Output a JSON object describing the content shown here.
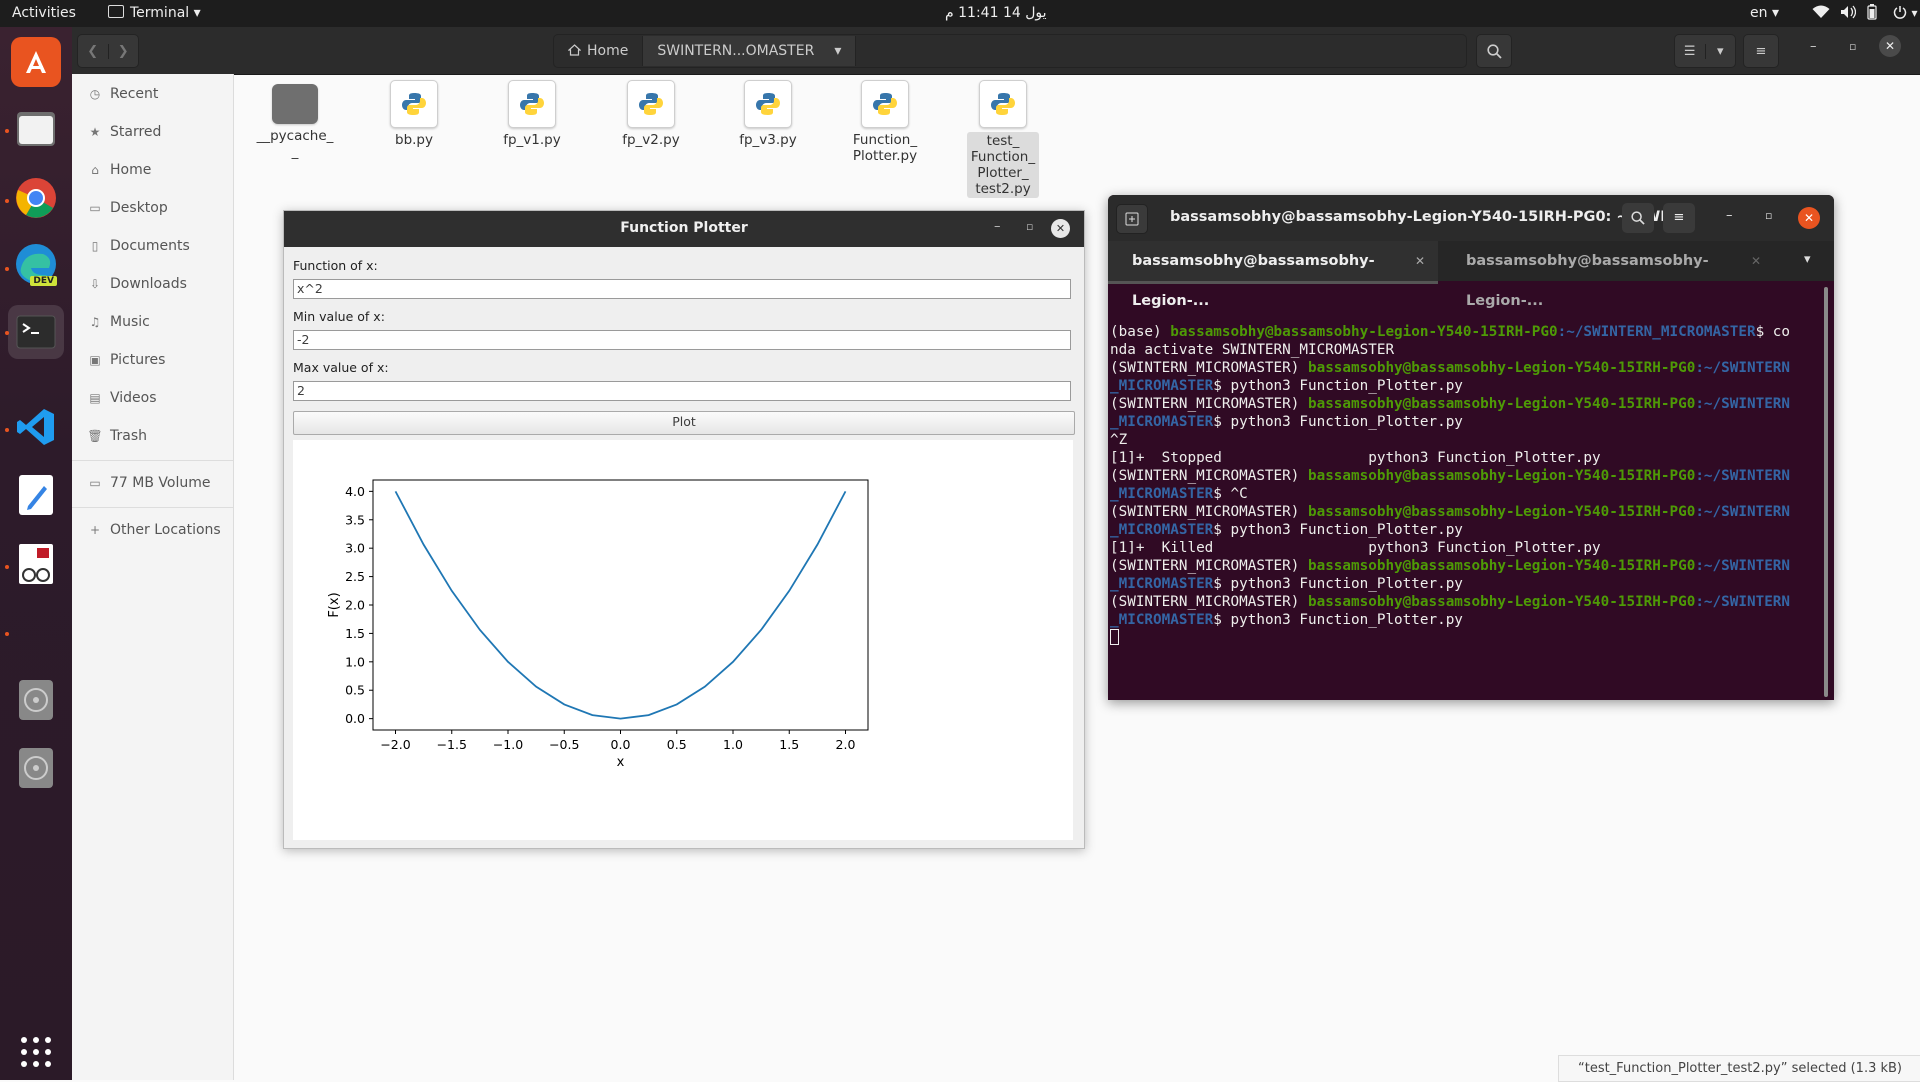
{
  "topbar": {
    "activities": "Activities",
    "app_menu": "Terminal",
    "clock": "يول 14  11:41 م",
    "lang": "en"
  },
  "files": {
    "path_home": "Home",
    "path_current": "SWINTERN...OMASTER",
    "sidebar": [
      "Recent",
      "Starred",
      "Home",
      "Desktop",
      "Documents",
      "Downloads",
      "Music",
      "Pictures",
      "Videos",
      "Trash",
      "77 MB Volume",
      "Other Locations"
    ],
    "items": [
      {
        "name_l1": "__pycache_",
        "name_l2": "_"
      },
      {
        "name_l1": "bb.py",
        "name_l2": ""
      },
      {
        "name_l1": "fp_v1.py",
        "name_l2": ""
      },
      {
        "name_l1": "fp_v2.py",
        "name_l2": ""
      },
      {
        "name_l1": "fp_v3.py",
        "name_l2": ""
      },
      {
        "name_l1": "Function_",
        "name_l2": "Plotter.py"
      },
      {
        "name_l1": "test_",
        "name_l2": "Function_",
        "name_l3": "Plotter_",
        "name_l4": "test2.py"
      }
    ],
    "status": "“test_Function_Plotter_test2.py” selected  (1.3 kB)"
  },
  "plotter": {
    "title": "Function Plotter",
    "func_label": "Function of x:",
    "func_value": "x^2",
    "min_label": "Min value of x:",
    "min_value": "-2",
    "max_label": "Max value of x:",
    "max_value": "2",
    "plot_label": "Plot"
  },
  "chart_data": {
    "type": "line",
    "title": "",
    "xlabel": "x",
    "ylabel": "F(x)",
    "xlim": [
      -2.2,
      2.2
    ],
    "ylim": [
      -0.2,
      4.2
    ],
    "xticks": [
      "−2.0",
      "−1.5",
      "−1.0",
      "−0.5",
      "0.0",
      "0.5",
      "1.0",
      "1.5",
      "2.0"
    ],
    "xtick_values": [
      -2.0,
      -1.5,
      -1.0,
      -0.5,
      0.0,
      0.5,
      1.0,
      1.5,
      2.0
    ],
    "yticks": [
      "0.0",
      "0.5",
      "1.0",
      "1.5",
      "2.0",
      "2.5",
      "3.0",
      "3.5",
      "4.0"
    ],
    "ytick_values": [
      0.0,
      0.5,
      1.0,
      1.5,
      2.0,
      2.5,
      3.0,
      3.5,
      4.0
    ],
    "x": [
      -2.0,
      -1.75,
      -1.5,
      -1.25,
      -1.0,
      -0.75,
      -0.5,
      -0.25,
      0.0,
      0.25,
      0.5,
      0.75,
      1.0,
      1.25,
      1.5,
      1.75,
      2.0
    ],
    "series": [
      {
        "values": [
          4.0,
          3.0625,
          2.25,
          1.5625,
          1.0,
          0.5625,
          0.25,
          0.0625,
          0.0,
          0.0625,
          0.25,
          0.5625,
          1.0,
          1.5625,
          2.25,
          3.0625,
          4.0
        ]
      }
    ],
    "line_color": "#1f77b4",
    "grid": false
  },
  "terminal": {
    "title": "bassamsobhy@bassamsobhy-Legion-Y540-15IRH-PG0: ~/SWI...",
    "tab1": "bassamsobhy@bassamsobhy-Legion-...",
    "tab2": "bassamsobhy@bassamsobhy-Legion-...",
    "lines": [
      {
        "pre": "(base) ",
        "user": "bassamsobhy@bassamsobhy-Legion-Y540-15IRH-PG0",
        "path": ":~/SWINTERN_MICROMASTER",
        "cmd": "$ co"
      },
      {
        "pre": "nda activate SWINTERN_MICROMASTER",
        "user": "",
        "path": "",
        "cmd": ""
      },
      {
        "pre": "(SWINTERN_MICROMASTER) ",
        "user": "bassamsobhy@bassamsobhy-Legion-Y540-15IRH-PG0",
        "path": ":~/SWINTERN",
        "cmd": ""
      },
      {
        "pre": "",
        "user": "",
        "path": "_MICROMASTER",
        "cmd": "$ python3 Function_Plotter.py"
      },
      {
        "pre": "(SWINTERN_MICROMASTER) ",
        "user": "bassamsobhy@bassamsobhy-Legion-Y540-15IRH-PG0",
        "path": ":~/SWINTERN",
        "cmd": ""
      },
      {
        "pre": "",
        "user": "",
        "path": "_MICROMASTER",
        "cmd": "$ python3 Function_Plotter.py"
      },
      {
        "pre": "^Z",
        "user": "",
        "path": "",
        "cmd": ""
      },
      {
        "pre": "[1]+  Stopped                 python3 Function_Plotter.py",
        "user": "",
        "path": "",
        "cmd": ""
      },
      {
        "pre": "(SWINTERN_MICROMASTER) ",
        "user": "bassamsobhy@bassamsobhy-Legion-Y540-15IRH-PG0",
        "path": ":~/SWINTERN",
        "cmd": ""
      },
      {
        "pre": "",
        "user": "",
        "path": "_MICROMASTER",
        "cmd": "$ ^C"
      },
      {
        "pre": "(SWINTERN_MICROMASTER) ",
        "user": "bassamsobhy@bassamsobhy-Legion-Y540-15IRH-PG0",
        "path": ":~/SWINTERN",
        "cmd": ""
      },
      {
        "pre": "",
        "user": "",
        "path": "_MICROMASTER",
        "cmd": "$ python3 Function_Plotter.py"
      },
      {
        "pre": "[1]+  Killed                  python3 Function_Plotter.py",
        "user": "",
        "path": "",
        "cmd": ""
      },
      {
        "pre": "(SWINTERN_MICROMASTER) ",
        "user": "bassamsobhy@bassamsobhy-Legion-Y540-15IRH-PG0",
        "path": ":~/SWINTERN",
        "cmd": ""
      },
      {
        "pre": "",
        "user": "",
        "path": "_MICROMASTER",
        "cmd": "$ python3 Function_Plotter.py"
      },
      {
        "pre": "(SWINTERN_MICROMASTER) ",
        "user": "bassamsobhy@bassamsobhy-Legion-Y540-15IRH-PG0",
        "path": ":~/SWINTERN",
        "cmd": ""
      },
      {
        "pre": "",
        "user": "",
        "path": "_MICROMASTER",
        "cmd": "$ python3 Function_Plotter.py"
      }
    ]
  },
  "dock": {
    "vscode_badge": "DEV"
  },
  "icons": [
    "ubuntu-software-icon",
    "files-icon",
    "chrome-icon",
    "edge-dev-icon",
    "terminal-icon",
    "vscode-icon",
    "text-editor-icon",
    "document-viewer-icon",
    "disc-icon",
    "disc-icon",
    "app-grid-icon"
  ]
}
